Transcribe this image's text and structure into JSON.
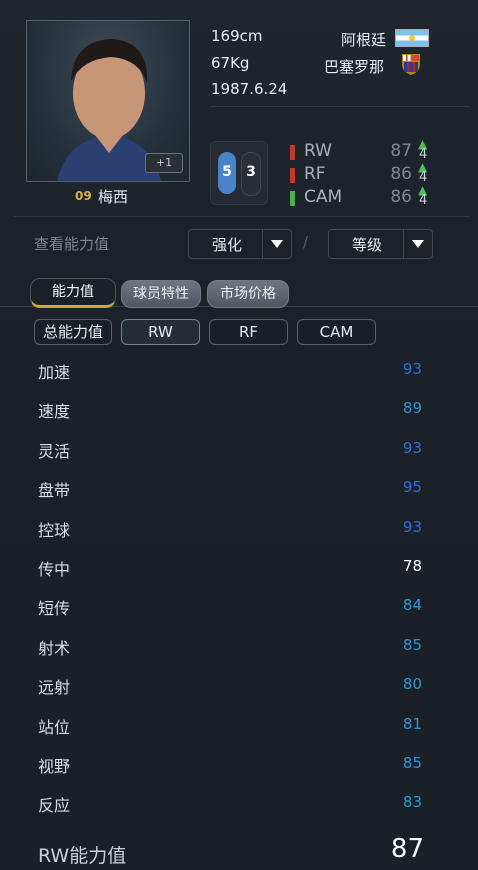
{
  "player": {
    "name": "梅西",
    "number": "09",
    "plus": "+1",
    "height": "169cm",
    "weight": "67Kg",
    "birthday": "1987.6.24",
    "nation": "阿根廷",
    "club": "巴塞罗那",
    "flag_icon": "argentina-flag-icon",
    "club_icon": "barcelona-crest-icon"
  },
  "feet": {
    "left": "5",
    "right": "3"
  },
  "positions": [
    {
      "name": "RW",
      "value": "87",
      "boost": "4",
      "color": "#c0392b"
    },
    {
      "name": "RF",
      "value": "86",
      "boost": "4",
      "color": "#c0392b"
    },
    {
      "name": "CAM",
      "value": "86",
      "boost": "4",
      "color": "#4caf50"
    }
  ],
  "controls": {
    "view_label": "查看能力值",
    "enhance_label": "强化",
    "level_label": "等级",
    "separator": "/"
  },
  "tabs": [
    "能力值",
    "球员特性",
    "市场价格"
  ],
  "filters": [
    "总能力值",
    "RW",
    "RF",
    "CAM"
  ],
  "stats": [
    {
      "name": "加速",
      "value": "93",
      "color": "#2f6fe0"
    },
    {
      "name": "速度",
      "value": "89",
      "color": "#2f95d6"
    },
    {
      "name": "灵活",
      "value": "93",
      "color": "#2f6fe0"
    },
    {
      "name": "盘带",
      "value": "95",
      "color": "#2f6fe0"
    },
    {
      "name": "控球",
      "value": "93",
      "color": "#2f6fe0"
    },
    {
      "name": "传中",
      "value": "78",
      "color": "#ffffff"
    },
    {
      "name": "短传",
      "value": "84",
      "color": "#2f95d6"
    },
    {
      "name": "射术",
      "value": "85",
      "color": "#2f95d6"
    },
    {
      "name": "远射",
      "value": "80",
      "color": "#2f95d6"
    },
    {
      "name": "站位",
      "value": "81",
      "color": "#2f95d6"
    },
    {
      "name": "视野",
      "value": "85",
      "color": "#2f95d6"
    },
    {
      "name": "反应",
      "value": "83",
      "color": "#2f95d6"
    }
  ],
  "total": {
    "label": "RW能力值",
    "value": "87"
  }
}
